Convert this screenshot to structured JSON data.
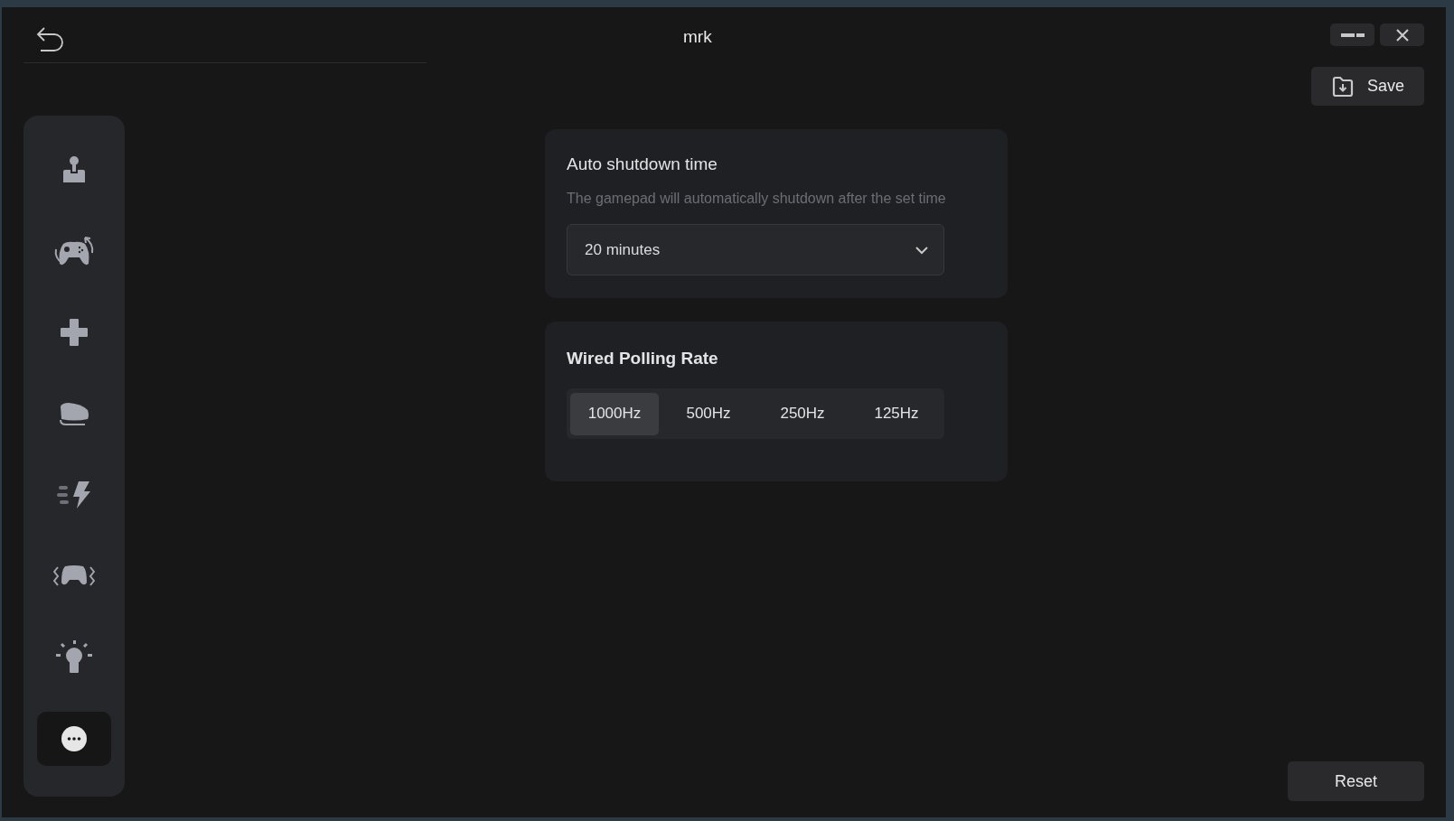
{
  "window": {
    "title": "mrk"
  },
  "sidebar": {
    "items": [
      {
        "selected": false
      },
      {
        "selected": false
      },
      {
        "selected": false
      },
      {
        "selected": false
      },
      {
        "selected": false
      },
      {
        "selected": false
      },
      {
        "selected": false
      },
      {
        "selected": true
      }
    ]
  },
  "auto_shutdown": {
    "title": "Auto shutdown time",
    "description": "The gamepad will automatically shutdown after the set time",
    "dropdown": {
      "value": "20 minutes"
    }
  },
  "polling_rate": {
    "title": "Wired Polling Rate",
    "options": [
      {
        "label": "1000Hz",
        "selected": true
      },
      {
        "label": "500Hz",
        "selected": false
      },
      {
        "label": "250Hz",
        "selected": false
      },
      {
        "label": "125Hz",
        "selected": false
      }
    ]
  },
  "buttons": {
    "save": "Save",
    "reset": "Reset"
  }
}
